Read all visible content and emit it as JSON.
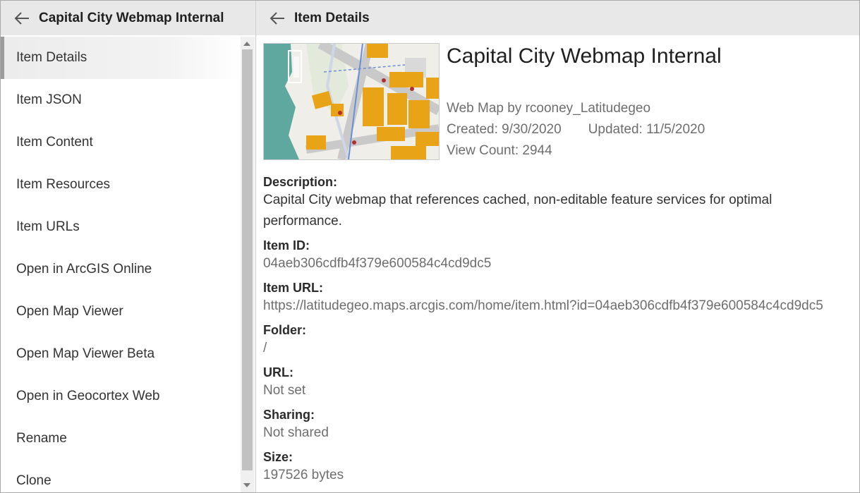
{
  "left_panel": {
    "title": "Capital City Webmap Internal",
    "menu": [
      {
        "label": "Item Details"
      },
      {
        "label": "Item JSON"
      },
      {
        "label": "Item Content"
      },
      {
        "label": "Item Resources"
      },
      {
        "label": "Item URLs"
      },
      {
        "label": "Open in ArcGIS Online"
      },
      {
        "label": "Open Map Viewer"
      },
      {
        "label": "Open Map Viewer Beta"
      },
      {
        "label": "Open in Geocortex Web"
      },
      {
        "label": "Rename"
      },
      {
        "label": "Clone"
      }
    ],
    "active_index": 0
  },
  "right_panel": {
    "header_title": "Item Details",
    "item_title": "Capital City Webmap Internal",
    "type_owner": "Web Map by rcooney_Latitudegeo",
    "created": "Created: 9/30/2020",
    "updated": "Updated: 11/5/2020",
    "view_count": "View Count: 2944",
    "fields": {
      "description_label": "Description:",
      "description": "Capital City webmap that references cached, non-editable feature services for optimal performance.",
      "item_id_label": "Item ID:",
      "item_id": "04aeb306cdfb4f379e600584c4cd9dc5",
      "item_url_label": "Item URL:",
      "item_url": "https://latitudegeo.maps.arcgis.com/home/item.html?id=04aeb306cdfb4f379e600584c4cd9dc5",
      "folder_label": "Folder:",
      "folder": "/",
      "url_label": "URL:",
      "url": "Not set",
      "sharing_label": "Sharing:",
      "sharing": "Not shared",
      "size_label": "Size:",
      "size": "197526 bytes"
    }
  },
  "icons": {
    "back": "arrow-left-icon",
    "thumbnail": "map-thumbnail"
  },
  "colors": {
    "header_bg": "#e8e8e8",
    "active_bar": "#9b9b9b",
    "map_water": "#5fa8a0",
    "map_building": "#e8a317"
  }
}
